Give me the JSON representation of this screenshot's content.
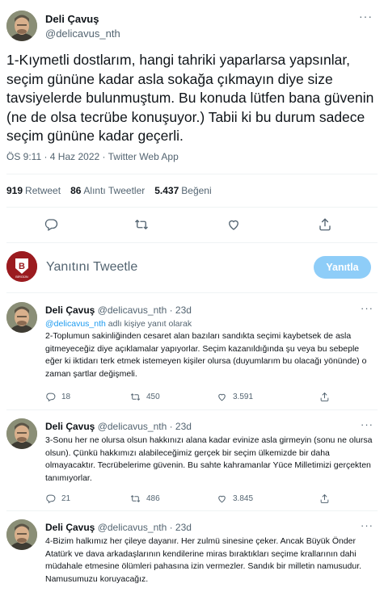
{
  "main_tweet": {
    "name": "Deli Çavuş",
    "handle": "@delicavus_nth",
    "more": "···",
    "text": "1-Kıymetli dostlarım, hangi tahriki yaparlarsa yapsınlar, seçim gününe kadar asla sokağa çıkmayın diye size tavsiyelerde bulunmuştum. Bu konuda lütfen bana güvenin (ne de olsa tecrübe konuşuyor.) Tabii ki bu durum sadece seçim gününe kadar geçerli.",
    "meta": "ÖS 9:11 · 4 Haz 2022 · Twitter Web App",
    "stats": {
      "retweets_count": "919",
      "retweets_label": "Retweet",
      "quotes_count": "86",
      "quotes_label": "Alıntı Tweetler",
      "likes_count": "5.437",
      "likes_label": "Beğeni"
    }
  },
  "reply_composer": {
    "placeholder": "Yanıtını Tweetle",
    "button_label": "Yanıtla",
    "avatar_letter": "B",
    "avatar_sub": "BİRGÜN"
  },
  "replies": [
    {
      "name": "Deli Çavuş",
      "handle": "@delicavus_nth · 23d",
      "replying_mention": "@delicavus_nth",
      "replying_suffix": " adlı kişiye yanıt olarak",
      "text": "2-Toplumun sakinliğinden cesaret alan bazıları sandıkta seçimi kaybetsek de asla gitmeyeceğiz diye açıklamalar yapıyorlar. Seçim kazanıldığında şu veya bu sebeple eğer ki iktidarı terk etmek istemeyen kişiler olursa (duyumlarım bu olacağı yönünde) o zaman şartlar değişmeli.",
      "replies": "18",
      "retweets": "450",
      "likes": "3.591"
    },
    {
      "name": "Deli Çavuş",
      "handle": "@delicavus_nth · 23d",
      "text": "3-Sonu her ne olursa olsun hakkınızı alana kadar evinize asla girmeyin (sonu ne olursa olsun). Çünkü hakkımızı alabileceğimiz gerçek bir seçim ülkemizde bir daha olmayacaktır. Tecrübelerime güvenin. Bu sahte kahramanlar Yüce Milletimizi gerçekten tanımıyorlar.",
      "replies": "21",
      "retweets": "486",
      "likes": "3.845"
    },
    {
      "name": "Deli Çavuş",
      "handle": "@delicavus_nth · 23d",
      "text": "4-Bizim halkımız her çileye dayanır. Her zulmü sinesine çeker. Ancak Büyük Önder Atatürk ve dava arkadaşlarının kendilerine miras bıraktıkları seçime krallarının dahi müdahale etmesine ölümleri pahasına izin vermezler. Sandık bir milletin namusudur. Namusumuzu koruyacağız."
    }
  ],
  "icons": {
    "reply": "reply-icon",
    "retweet": "retweet-icon",
    "like": "heart-icon",
    "share": "share-icon",
    "more": "more-icon"
  },
  "colors": {
    "accent": "#1d9bf0",
    "reply_button": "#8ecdf8",
    "muted_text": "#536471",
    "composer_avatar": "#9b1b1f"
  }
}
